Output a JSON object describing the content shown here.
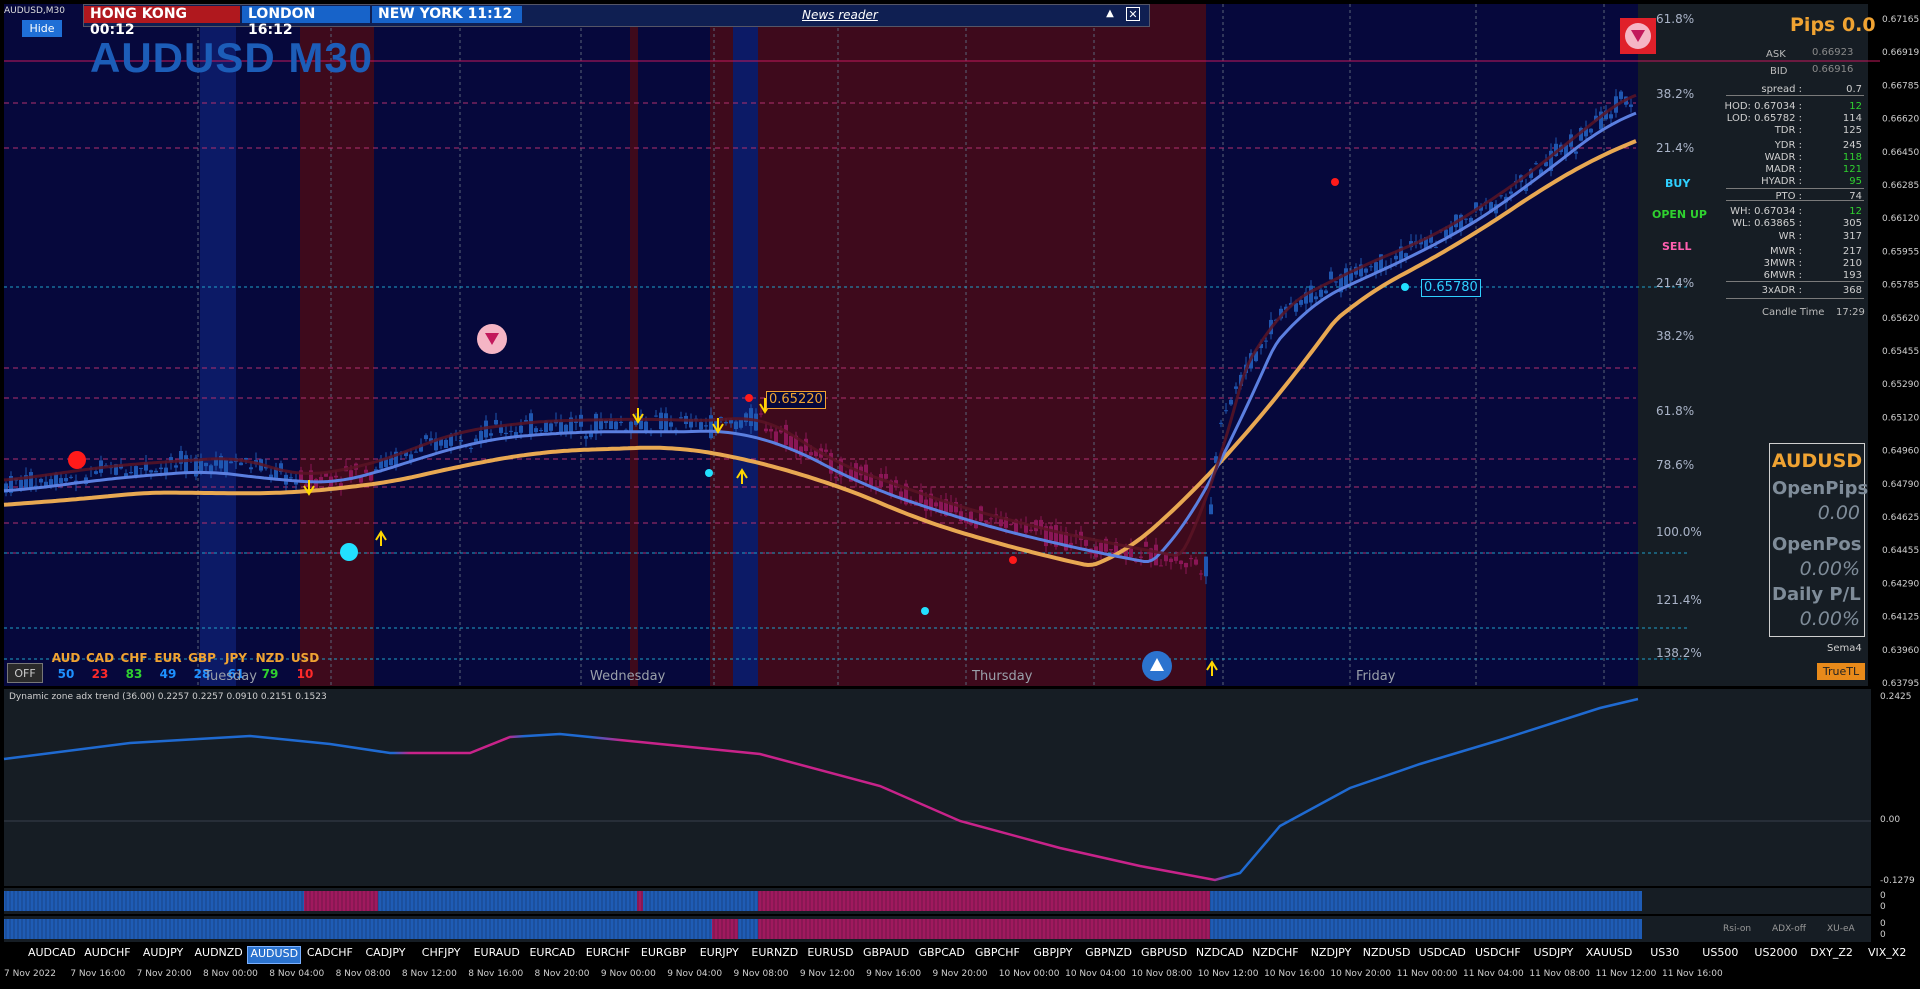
{
  "window_title": "AUDUSD,M30",
  "hide_label": "Hide",
  "chart_title": "AUDUSD M30",
  "sessions": [
    {
      "label": "HONG KONG 00:12",
      "color": "#b0181e"
    },
    {
      "label": "LONDON  16:12",
      "color": "#1763c9"
    },
    {
      "label": "NEW YORK 11:12",
      "color": "#1763c9"
    }
  ],
  "news_reader": "News reader",
  "pips_header": "Pips 0.0",
  "quote": {
    "ask_label": "ASK",
    "ask_value": "0.66923",
    "bid_label": "BID",
    "bid_value": "0.66916"
  },
  "stats": [
    {
      "label": "spread :",
      "value": "0.7",
      "value_color": "#cfcfcf"
    },
    {
      "label": "HOD: 0.67034 :",
      "value": "12",
      "value_color": "#2fd12f"
    },
    {
      "label": "LOD: 0.65782 :",
      "value": "114",
      "value_color": "#cfcfcf"
    },
    {
      "label": "TDR :",
      "value": "125",
      "value_color": "#cfcfcf"
    },
    {
      "label": "YDR :",
      "value": "245",
      "value_color": "#cfcfcf"
    },
    {
      "label": "WADR :",
      "value": "118",
      "value_color": "#2fd12f"
    },
    {
      "label": "MADR :",
      "value": "121",
      "value_color": "#2fd12f"
    },
    {
      "label": "HYADR :",
      "value": "95",
      "value_color": "#2fd12f"
    },
    {
      "label": "PTO :",
      "value": "74",
      "value_color": "#cfcfcf"
    },
    {
      "label": "WH: 0.67034 :",
      "value": "12",
      "value_color": "#2fd12f"
    },
    {
      "label": "WL: 0.63865 :",
      "value": "305",
      "value_color": "#cfcfcf"
    },
    {
      "label": "WR :",
      "value": "317",
      "value_color": "#cfcfcf"
    },
    {
      "label": "MWR :",
      "value": "217",
      "value_color": "#cfcfcf"
    },
    {
      "label": "3MWR :",
      "value": "210",
      "value_color": "#cfcfcf"
    },
    {
      "label": "6MWR :",
      "value": "193",
      "value_color": "#cfcfcf"
    },
    {
      "label": "3xADR :",
      "value": "368",
      "value_color": "#cfcfcf"
    }
  ],
  "candle_time": {
    "label": "Candle Time",
    "value": "17:29"
  },
  "signals": {
    "buy": "BUY",
    "open_up": "OPEN UP",
    "sell": "SELL"
  },
  "open_box": {
    "symbol": "AUDUSD",
    "open_pips_label": "OpenPips",
    "open_pips_value": "0.00",
    "open_pos_label": "OpenPos",
    "open_pos_value": "0.00%",
    "daily_pl_label": "Daily P/L",
    "daily_pl_value": "0.00%"
  },
  "sema_label": "Sema4",
  "truetl_label": "TrueTL",
  "off_label": "OFF",
  "currency_strength": [
    {
      "code": "AUD",
      "value": "50",
      "color": "#1e90ff"
    },
    {
      "code": "CAD",
      "value": "23",
      "color": "#ff2a2a"
    },
    {
      "code": "CHF",
      "value": "83",
      "color": "#2fd12f"
    },
    {
      "code": "EUR",
      "value": "49",
      "color": "#1e90ff"
    },
    {
      "code": "GBP",
      "value": "28",
      "color": "#1e90ff"
    },
    {
      "code": "JPY",
      "value": "61",
      "color": "#1e90ff"
    },
    {
      "code": "NZD",
      "value": "79",
      "color": "#2fd12f"
    },
    {
      "code": "USD",
      "value": "10",
      "color": "#ff2a2a"
    }
  ],
  "day_labels": [
    "Tuesday",
    "Wednesday",
    "Thursday",
    "Friday"
  ],
  "price_labels": [
    "0.67165",
    "0.66919",
    "0.66785",
    "0.66620",
    "0.66450",
    "0.66285",
    "0.66120",
    "0.65955",
    "0.65785",
    "0.65620",
    "0.65455",
    "0.65290",
    "0.65120",
    "0.64960",
    "0.64790",
    "0.64625",
    "0.64455",
    "0.64290",
    "0.64125",
    "0.63960",
    "0.63795"
  ],
  "fib_levels": [
    "61.8%",
    "38.2%",
    "21.4%",
    "21.4%",
    "38.2%",
    "61.8%",
    "78.6%",
    "100.0%",
    "121.4%",
    "138.2%"
  ],
  "price_tags": {
    "top": "0.65220",
    "mid": "0.65780"
  },
  "indicator": {
    "title": "Dynamic zone adx trend (36.00) 0.2257 0.2257 0.0910 0.2151 0.1523",
    "scale": [
      "0.2425",
      "0.00",
      "-0.1279"
    ]
  },
  "strip_scale": [
    "0",
    "0",
    "0",
    "0"
  ],
  "strip_labels": {
    "rsi": "Rsi-on",
    "adx": "ADX-off",
    "xu": "XU-eA"
  },
  "symbols": [
    "AUDCAD",
    "AUDCHF",
    "AUDJPY",
    "AUDNZD",
    "AUDUSD",
    "CADCHF",
    "CADJPY",
    "CHFJPY",
    "EURAUD",
    "EURCAD",
    "EURCHF",
    "EURGBP",
    "EURJPY",
    "EURNZD",
    "EURUSD",
    "GBPAUD",
    "GBPCAD",
    "GBPCHF",
    "GBPJPY",
    "GBPNZD",
    "GBPUSD",
    "NZDCAD",
    "NZDCHF",
    "NZDJPY",
    "NZDUSD",
    "USDCAD",
    "USDCHF",
    "USDJPY",
    "XAUUSD",
    "US30",
    "US500",
    "US2000",
    "DXY_Z2",
    "VIX_X2"
  ],
  "active_symbol": "AUDUSD",
  "time_labels": [
    "7 Nov 2022",
    "7 Nov 16:00",
    "7 Nov 20:00",
    "8 Nov 00:00",
    "8 Nov 04:00",
    "8 Nov 08:00",
    "8 Nov 12:00",
    "8 Nov 16:00",
    "8 Nov 20:00",
    "9 Nov 00:00",
    "9 Nov 04:00",
    "9 Nov 08:00",
    "9 Nov 12:00",
    "9 Nov 16:00",
    "9 Nov 20:00",
    "10 Nov 00:00",
    "10 Nov 04:00",
    "10 Nov 08:00",
    "10 Nov 12:00",
    "10 Nov 16:00",
    "10 Nov 20:00",
    "11 Nov 00:00",
    "11 Nov 04:00",
    "11 Nov 08:00",
    "11 Nov 12:00",
    "11 Nov 16:00"
  ],
  "chart_data": {
    "type": "candlestick",
    "symbol": "AUDUSD",
    "timeframe": "M30",
    "y_range": [
      0.63795,
      0.67165
    ],
    "ask": 0.66923,
    "bid": 0.66916,
    "hod": 0.67034,
    "lod": 0.65782,
    "marked_levels": [
      0.6522,
      0.6578
    ],
    "indicator_range": [
      -0.1279,
      0.2425
    ]
  }
}
